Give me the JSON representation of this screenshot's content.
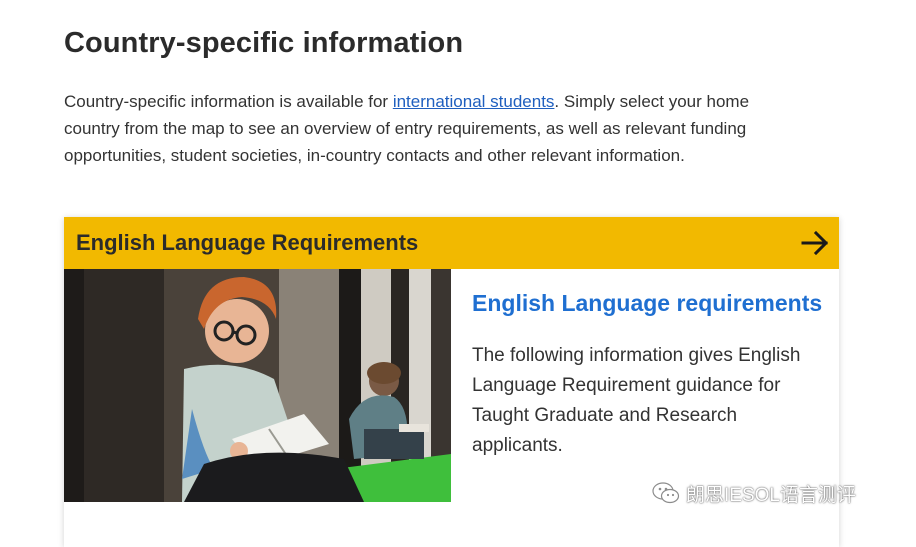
{
  "page": {
    "title": "Country-specific information",
    "intro_before_link": "Country-specific information is available for ",
    "intro_link": "international students",
    "intro_after_link": ". Simply select your home country from the map to see an overview of entry requirements, as well as relevant funding opportunities, student societies, in-country contacts and other relevant information."
  },
  "card": {
    "header_title": "English Language Requirements",
    "header_icon": "arrow-right-icon",
    "body_title": "English Language requirements",
    "body_text": "The following information gives English Language Requirement guidance for Taught Graduate and Research applicants.",
    "image_icon": "student-reading-photo"
  },
  "watermark": {
    "icon": "wechat-icon",
    "text": "朗思IESOL语言测评"
  },
  "colors": {
    "header_bg": "#f2b900",
    "link": "#1f5fbf",
    "body_title": "#1f6fd1",
    "text": "#333333"
  }
}
